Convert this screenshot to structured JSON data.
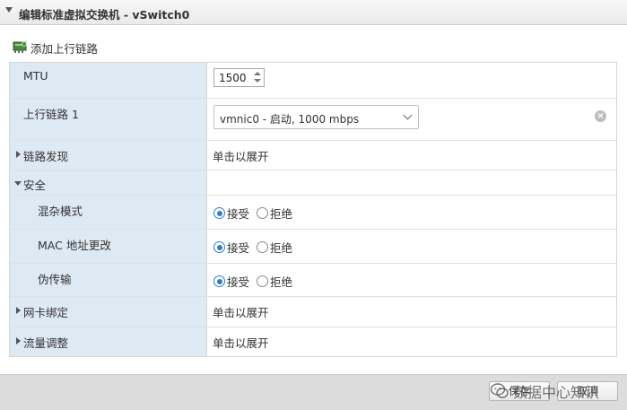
{
  "window": {
    "title": "编辑标准虚拟交换机 - vSwitch0"
  },
  "toolbar": {
    "add_uplink_label": "添加上行链路"
  },
  "form": {
    "mtu": {
      "label": "MTU",
      "value": "1500"
    },
    "uplink": {
      "label": "上行链路 1",
      "selected": "vmnic0 - 启动, 1000 mbps"
    },
    "link_discovery": {
      "label": "链路发现",
      "value": "单击以展开"
    },
    "security": {
      "label": "安全",
      "rows": [
        {
          "label": "混杂模式",
          "accept": "接受",
          "reject": "拒绝",
          "selected": "接受"
        },
        {
          "label": "MAC 地址更改",
          "accept": "接受",
          "reject": "拒绝",
          "selected": "接受"
        },
        {
          "label": "伪传输",
          "accept": "接受",
          "reject": "拒绝",
          "selected": "接受"
        }
      ]
    },
    "nic_teaming": {
      "label": "网卡绑定",
      "value": "单击以展开"
    },
    "traffic_shaping": {
      "label": "流量调整",
      "value": "单击以展开"
    }
  },
  "footer": {
    "save_label": "保存",
    "cancel_label": "取消",
    "watermark": "数据中心知识"
  },
  "colors": {
    "label_bg": "#dde9f3",
    "accent": "#2f7dc9"
  }
}
